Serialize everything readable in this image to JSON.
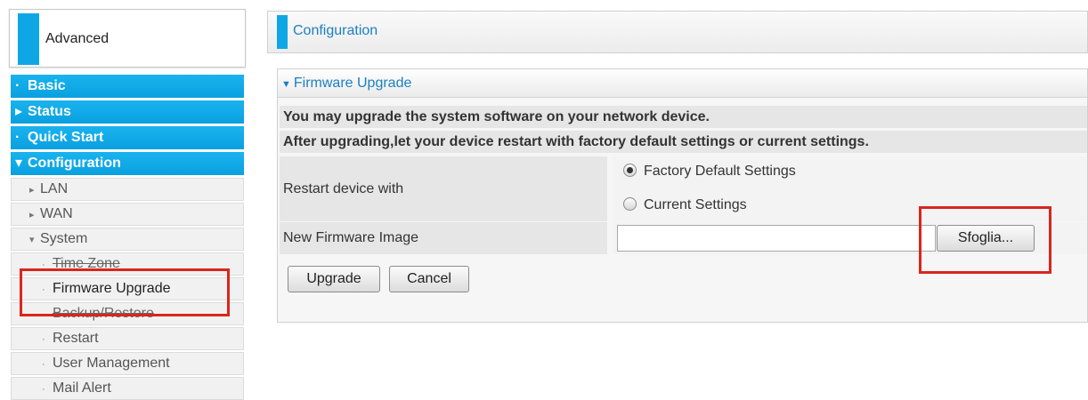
{
  "sidebar": {
    "advanced_label": "Advanced",
    "main_items": [
      {
        "marker": "·",
        "label": "Basic"
      },
      {
        "marker": "▸",
        "label": "Status"
      },
      {
        "marker": "·",
        "label": "Quick Start"
      },
      {
        "marker": "▾",
        "label": "Configuration"
      }
    ],
    "sub_items": [
      {
        "marker": "▸",
        "label": "LAN"
      },
      {
        "marker": "▸",
        "label": "WAN"
      },
      {
        "marker": "▾",
        "label": "System"
      },
      {
        "marker": "·",
        "label": "Time Zone"
      },
      {
        "marker": "·",
        "label": "Firmware Upgrade"
      },
      {
        "marker": "",
        "label": "Backup/Restore"
      },
      {
        "marker": "·",
        "label": "Restart"
      },
      {
        "marker": "·",
        "label": "User Management"
      },
      {
        "marker": "·",
        "label": "Mail Alert"
      }
    ]
  },
  "main": {
    "header_title": "Configuration",
    "section_title": "Firmware Upgrade",
    "info_line_1": "You may upgrade the system software on your network device.",
    "info_line_2": "After upgrading,let your device restart with factory default settings or current settings.",
    "restart_label": "Restart device with",
    "option_factory": "Factory Default Settings",
    "option_current": "Current Settings",
    "selected_option": "Factory Default Settings",
    "image_label": "New Firmware Image",
    "file_value": "",
    "browse_button": "Sfoglia...",
    "upgrade_button": "Upgrade",
    "cancel_button": "Cancel"
  },
  "colors": {
    "accent_blue": "#0fa6e6",
    "highlight_red": "#d9261c",
    "title_blue": "#1b7fc4"
  }
}
